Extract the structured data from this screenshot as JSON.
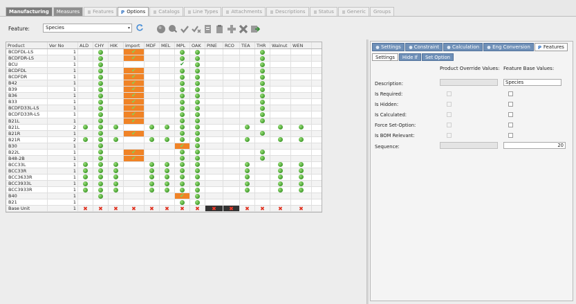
{
  "tabs": [
    "Manufacturing",
    "Measures",
    "Features",
    "Options",
    "Catalogs",
    "Line Types",
    "Attachments",
    "Descriptions",
    "Status",
    "Generic",
    "Groups"
  ],
  "toolbar": {
    "feature_label": "Feature:",
    "feature_value": "Species"
  },
  "grid": {
    "columns": [
      "Product",
      "Ver No",
      "ALD",
      "CHY",
      "HIK",
      "import",
      "MDF",
      "MEL",
      "MPL",
      "OAK",
      "PINE",
      "RCO",
      "TEA",
      "THR",
      "Walnut",
      "WEN"
    ],
    "rows": [
      {
        "product": "BCDFDL-LS",
        "ver": "1",
        "cells": [
          "",
          "d",
          "",
          "oc",
          "",
          "",
          "d",
          "d",
          "",
          "",
          "",
          "d",
          "",
          ""
        ]
      },
      {
        "product": "BCDFDR-LS",
        "ver": "1",
        "cells": [
          "",
          "d",
          "",
          "oc",
          "",
          "",
          "d",
          "d",
          "",
          "",
          "",
          "d",
          "",
          ""
        ]
      },
      {
        "product": "BCU",
        "ver": "1",
        "cells": [
          "",
          "d",
          "",
          "",
          "",
          "",
          "c",
          "d",
          "",
          "",
          "",
          "d",
          "",
          ""
        ]
      },
      {
        "product": "BCDFDL",
        "ver": "1",
        "cells": [
          "",
          "d",
          "",
          "oc",
          "",
          "",
          "d",
          "d",
          "",
          "",
          "",
          "d",
          "",
          ""
        ]
      },
      {
        "product": "BCDFDR",
        "ver": "1",
        "cells": [
          "",
          "d",
          "",
          "oc",
          "",
          "",
          "d",
          "d",
          "",
          "",
          "",
          "d",
          "",
          ""
        ]
      },
      {
        "product": "B42",
        "ver": "1",
        "cells": [
          "",
          "d",
          "",
          "oc",
          "",
          "",
          "d",
          "d",
          "",
          "",
          "",
          "d",
          "",
          ""
        ]
      },
      {
        "product": "B39",
        "ver": "1",
        "cells": [
          "",
          "d",
          "",
          "oc",
          "",
          "",
          "d",
          "d",
          "",
          "",
          "",
          "d",
          "",
          ""
        ]
      },
      {
        "product": "B36",
        "ver": "1",
        "cells": [
          "",
          "d",
          "",
          "oc",
          "",
          "",
          "d",
          "d",
          "",
          "",
          "",
          "d",
          "",
          ""
        ]
      },
      {
        "product": "B33",
        "ver": "1",
        "cells": [
          "",
          "d",
          "",
          "oc",
          "",
          "",
          "d",
          "d",
          "",
          "",
          "",
          "d",
          "",
          ""
        ]
      },
      {
        "product": "BCDFD33L-LS",
        "ver": "1",
        "cells": [
          "",
          "d",
          "",
          "oc",
          "",
          "",
          "d",
          "d",
          "",
          "",
          "",
          "d",
          "",
          ""
        ]
      },
      {
        "product": "BCDFD33R-LS",
        "ver": "1",
        "cells": [
          "",
          "d",
          "",
          "oc",
          "",
          "",
          "d",
          "d",
          "",
          "",
          "",
          "d",
          "",
          ""
        ]
      },
      {
        "product": "B21L",
        "ver": "1",
        "cells": [
          "",
          "d",
          "",
          "oc",
          "",
          "",
          "d",
          "d",
          "",
          "",
          "",
          "d",
          "",
          ""
        ]
      },
      {
        "product": "B21L",
        "ver": "2",
        "cells": [
          "d",
          "d",
          "d",
          "",
          "d",
          "d",
          "d",
          "d",
          "",
          "",
          "d",
          "",
          "d",
          "d"
        ]
      },
      {
        "product": "B21R",
        "ver": "1",
        "cells": [
          "",
          "d",
          "",
          "oc",
          "",
          "",
          "d",
          "d",
          "",
          "",
          "",
          "d",
          "",
          ""
        ]
      },
      {
        "product": "B21R",
        "ver": "2",
        "cells": [
          "d",
          "d",
          "d",
          "",
          "d",
          "d",
          "d",
          "d",
          "",
          "",
          "d",
          "",
          "d",
          "d"
        ]
      },
      {
        "product": "B30",
        "ver": "1",
        "cells": [
          "",
          "d",
          "",
          "",
          "",
          "",
          "oc",
          "d",
          "",
          "",
          "",
          "",
          "",
          ""
        ]
      },
      {
        "product": "B22L",
        "ver": "1",
        "cells": [
          "",
          "d",
          "",
          "oc",
          "",
          "",
          "d",
          "d",
          "",
          "",
          "",
          "d",
          "",
          ""
        ]
      },
      {
        "product": "B48-2B",
        "ver": "1",
        "cells": [
          "",
          "d",
          "",
          "oc",
          "",
          "",
          "d",
          "d",
          "",
          "",
          "",
          "d",
          "",
          ""
        ]
      },
      {
        "product": "BCC33L",
        "ver": "1",
        "cells": [
          "d",
          "d",
          "d",
          "",
          "d",
          "d",
          "d",
          "d",
          "",
          "",
          "d",
          "",
          "d",
          "d"
        ]
      },
      {
        "product": "BCC33R",
        "ver": "1",
        "cells": [
          "d",
          "d",
          "d",
          "",
          "d",
          "d",
          "d",
          "d",
          "",
          "",
          "d",
          "",
          "d",
          "d"
        ]
      },
      {
        "product": "BCC3633R",
        "ver": "1",
        "cells": [
          "d",
          "d",
          "d",
          "",
          "d",
          "d",
          "d",
          "d",
          "",
          "",
          "d",
          "",
          "d",
          "d"
        ]
      },
      {
        "product": "BCC3933L",
        "ver": "1",
        "cells": [
          "d",
          "d",
          "d",
          "",
          "d",
          "d",
          "d",
          "d",
          "",
          "",
          "d",
          "",
          "d",
          "d"
        ]
      },
      {
        "product": "BCC3933R",
        "ver": "1",
        "cells": [
          "d",
          "d",
          "d",
          "",
          "d",
          "d",
          "d",
          "d",
          "",
          "",
          "d",
          "",
          "d",
          "d"
        ]
      },
      {
        "product": "B40",
        "ver": "1",
        "cells": [
          "",
          "d",
          "",
          "",
          "",
          "",
          "oc",
          "d",
          "",
          "",
          "",
          "",
          "",
          ""
        ]
      },
      {
        "product": "B21",
        "ver": "1",
        "cells": [
          "",
          "",
          "",
          "",
          "",
          "",
          "d",
          "d",
          "",
          "",
          "",
          "",
          "",
          ""
        ]
      },
      {
        "product": "Base Unit",
        "ver": "1",
        "cells": [
          "x",
          "x",
          "x",
          "x",
          "x",
          "x",
          "x",
          "x",
          "bx",
          "bx",
          "x",
          "x",
          "x",
          "x"
        ]
      }
    ]
  },
  "right": {
    "tabs": [
      "Settings",
      "Constraint",
      "Calculation",
      "Eng Conversion",
      "Features"
    ],
    "subtabs": [
      "Settings",
      "Hide If",
      "Set Option"
    ],
    "col_override": "Product Override Values:",
    "col_base": "Feature Base Values:",
    "labels": {
      "description": "Description:",
      "required": "Is Required:",
      "hidden": "Is Hidden:",
      "calculated": "Is Calculated:",
      "force": "Force Set-Option:",
      "bom": "Is BOM Relevant:",
      "sequence": "Sequence:"
    },
    "base_description": "Species",
    "base_sequence": "20"
  }
}
